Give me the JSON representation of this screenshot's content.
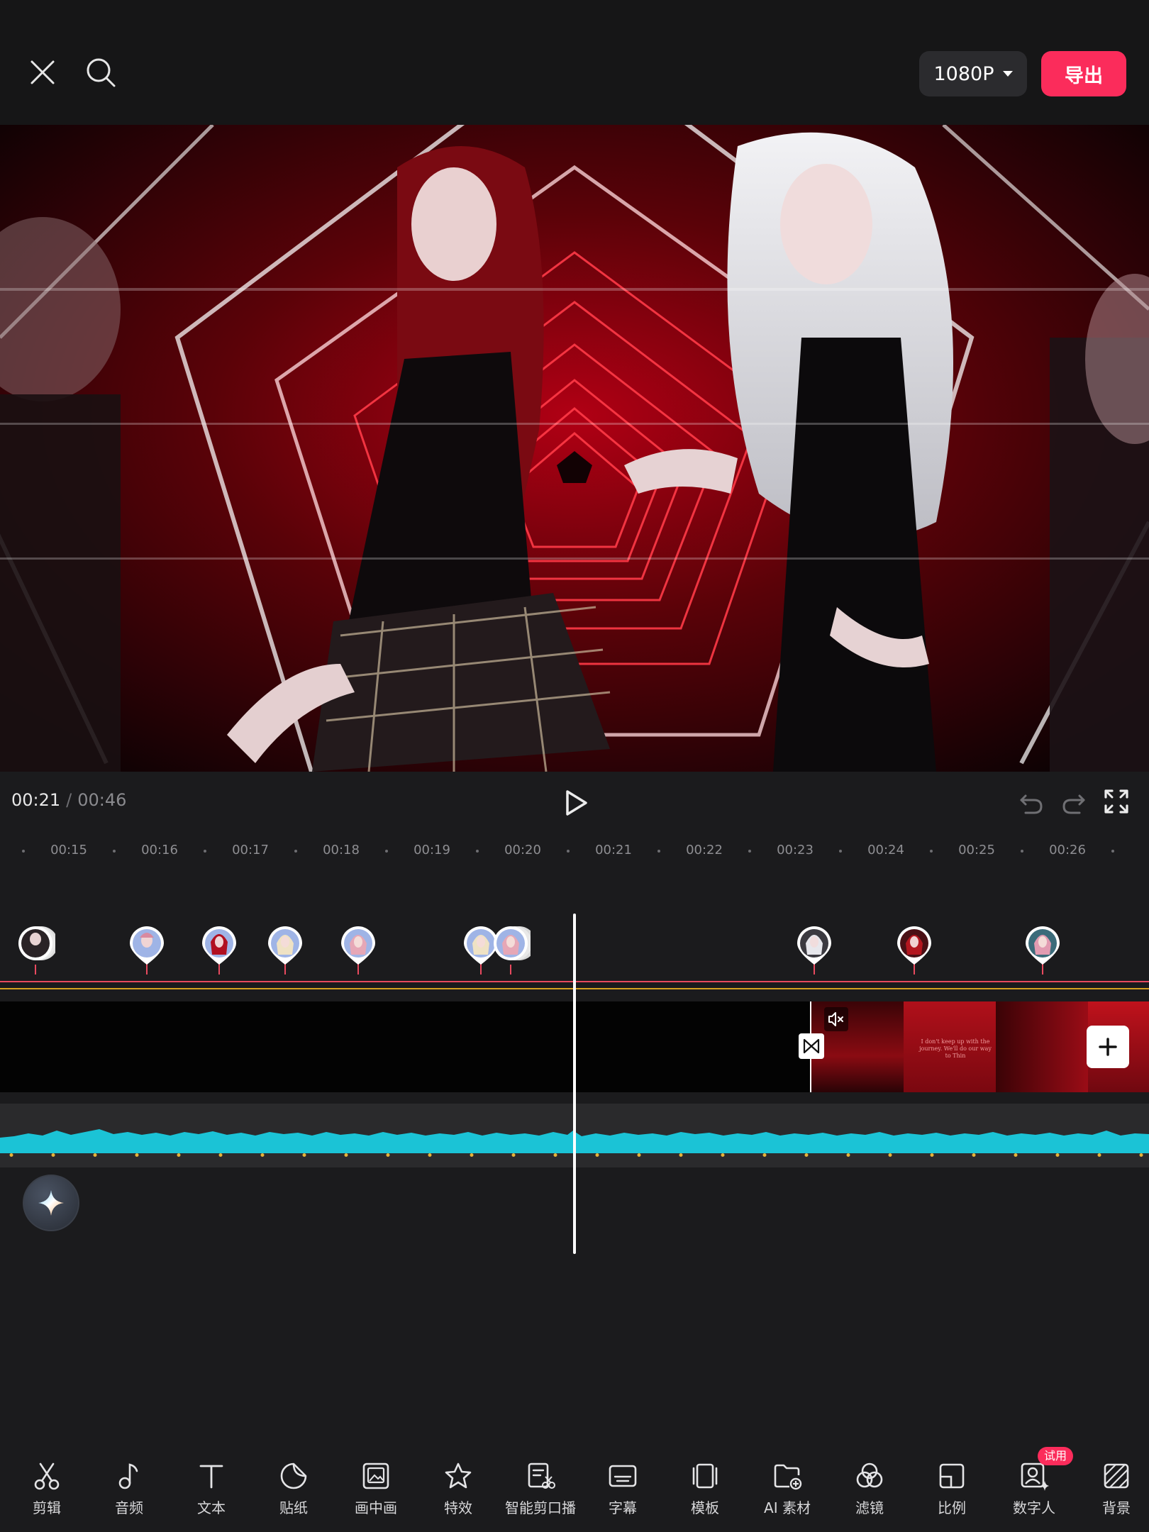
{
  "topbar": {
    "resolution_label": "1080P",
    "export_label": "导出"
  },
  "playback": {
    "current_time": "00:21",
    "separator": "/",
    "total_time": "00:46"
  },
  "ruler": {
    "labels": [
      "00:15",
      "00:16",
      "00:17",
      "00:18",
      "00:19",
      "00:20",
      "00:21",
      "00:22",
      "00:23",
      "00:24",
      "00:25",
      "00:26"
    ]
  },
  "video_clip": {
    "caption": "I don't keep up with the journey. We'll do our way to Thin"
  },
  "toolbar": {
    "items": [
      {
        "label": "剪辑",
        "icon": "scissors-icon"
      },
      {
        "label": "音频",
        "icon": "music-note-icon"
      },
      {
        "label": "文本",
        "icon": "text-icon"
      },
      {
        "label": "贴纸",
        "icon": "sticker-icon"
      },
      {
        "label": "画中画",
        "icon": "picture-in-picture-icon"
      },
      {
        "label": "特效",
        "icon": "effects-star-icon"
      },
      {
        "label": "智能剪口播",
        "icon": "smart-cut-icon"
      },
      {
        "label": "字幕",
        "icon": "subtitle-icon"
      },
      {
        "label": "模板",
        "icon": "template-icon"
      },
      {
        "label": "AI 素材",
        "icon": "ai-material-icon"
      },
      {
        "label": "滤镜",
        "icon": "filter-icon"
      },
      {
        "label": "比例",
        "icon": "ratio-icon"
      },
      {
        "label": "数字人",
        "icon": "digital-human-icon"
      },
      {
        "label": "背景",
        "icon": "background-icon"
      }
    ],
    "trial_badge": "试用"
  },
  "colors": {
    "accent": "#fb2c5b",
    "waveform": "#1bc3d6",
    "marker_line": "#e84a5f",
    "beat_line": "#d6a020"
  }
}
